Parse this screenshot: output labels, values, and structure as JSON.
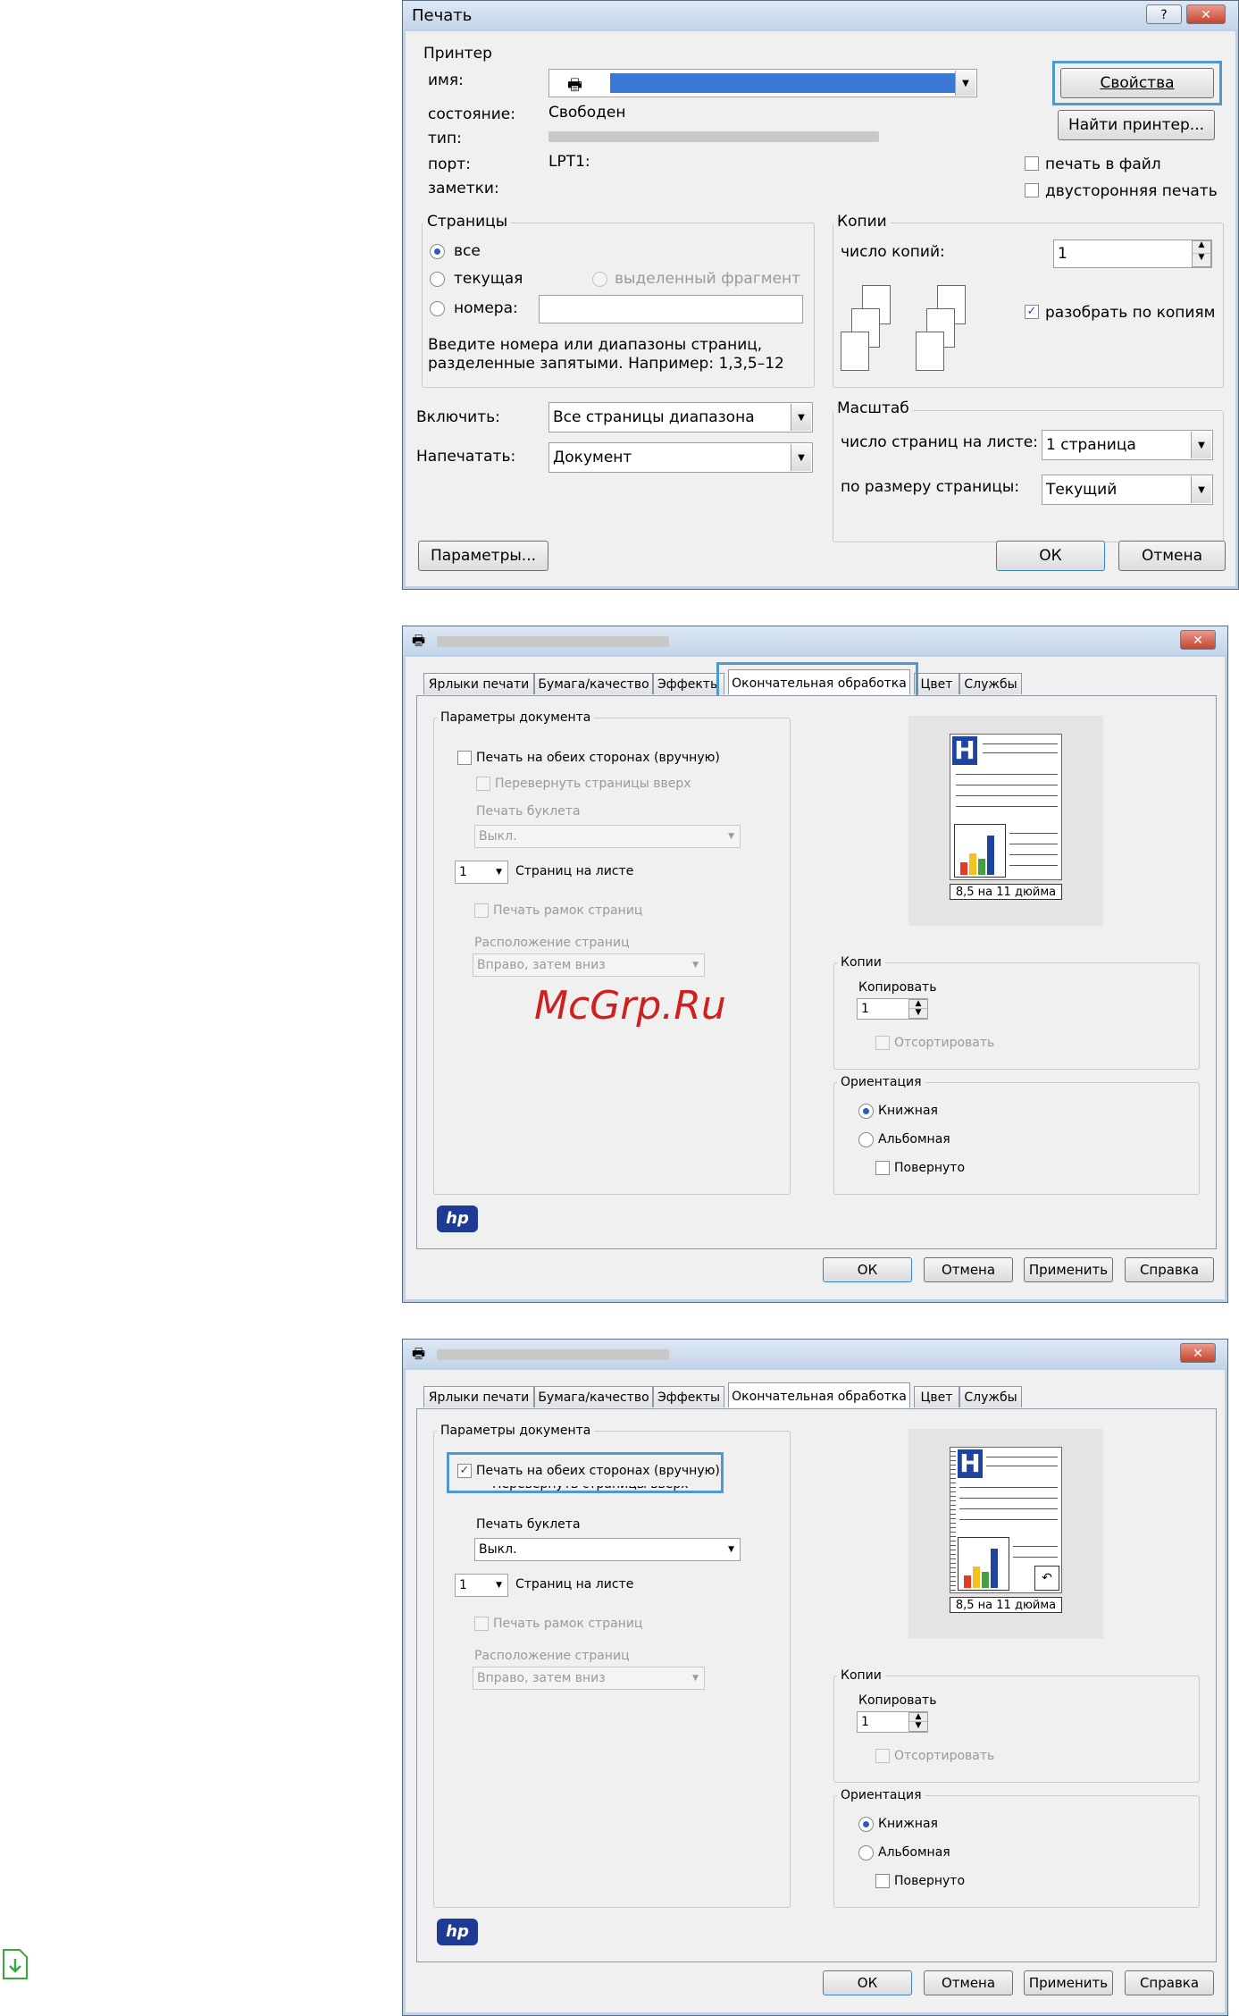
{
  "watermark": "McGrp.Ru",
  "dialog1": {
    "title": "Печать",
    "help_btn": "?",
    "close_btn": "✕",
    "printer_group": "Принтер",
    "name_label": "имя:",
    "status_label": "состояние:",
    "status_value": "Свободен",
    "type_label": "тип:",
    "port_label": "порт:",
    "port_value": "LPT1:",
    "notes_label": "заметки:",
    "properties_btn": "Свойства",
    "find_printer_btn": "Найти принтер...",
    "print_to_file": "печать в файл",
    "duplex": "двусторонняя печать",
    "pages_group": "Страницы",
    "pages_all": "все",
    "pages_current": "текущая",
    "pages_selection": "выделенный фрагмент",
    "pages_numbers": "номера:",
    "pages_hint_1": "Введите номера или диапазоны страниц,",
    "pages_hint_2": "разделенные запятыми. Например: 1,3,5–12",
    "copies_group": "Копии",
    "copies_label": "число копий:",
    "copies_value": "1",
    "collate": "разобрать по копиям",
    "include_label": "Включить:",
    "include_value": "Все страницы диапазона",
    "print_what_label": "Напечатать:",
    "print_what_value": "Документ",
    "scale_group": "Масштаб",
    "pages_per_sheet_label": "число страниц на листе:",
    "pages_per_sheet_value": "1 страница",
    "scale_to_label": "по размеру страницы:",
    "scale_to_value": "Текущий",
    "options_btn": "Параметры...",
    "ok_btn": "ОК",
    "cancel_btn": "Отмена"
  },
  "props_common": {
    "tabs": [
      "Ярлыки печати",
      "Бумага/качество",
      "Эффекты",
      "Окончательная обработка",
      "Цвет",
      "Службы"
    ],
    "doc_options_group": "Параметры документа",
    "print_both_sides": "Печать на обеих сторонах (вручную)",
    "flip_pages_up": "Перевернуть страницы вверх",
    "booklet_label": "Печать буклета",
    "booklet_value": "Выкл.",
    "pages_per_sheet_value": "1",
    "pages_per_sheet_label": "Страниц на листе",
    "print_page_borders": "Печать рамок страниц",
    "page_order_label": "Расположение страниц",
    "page_order_value": "Вправо, затем вниз",
    "paper_size_caption": "8,5 на 11 дюйма",
    "copies_group": "Копии",
    "copy_count_label": "Копировать",
    "copy_count_value": "1",
    "collate": "Отсортировать",
    "orientation_group": "Ориентация",
    "portrait": "Книжная",
    "landscape": "Альбомная",
    "rotated": "Повернуто",
    "hp_logo": "hp",
    "ok_btn": "ОК",
    "cancel_btn": "Отмена",
    "apply_btn": "Применить",
    "help_btn": "Справка",
    "close_btn": "✕"
  }
}
